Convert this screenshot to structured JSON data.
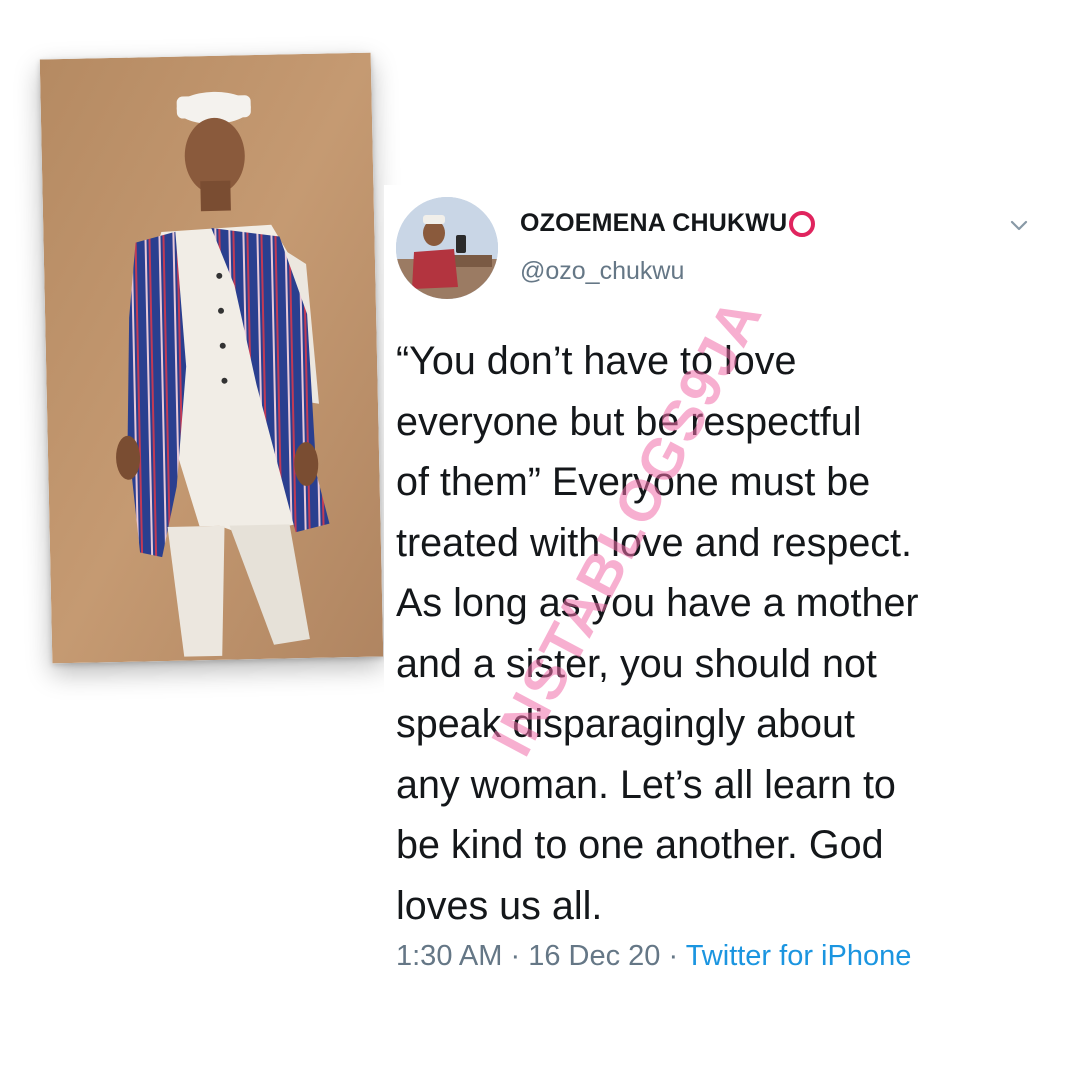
{
  "tweet": {
    "author": {
      "display_name": "OZOEMENA CHUKWU",
      "handle": "@ozo_chukwu"
    },
    "text": "“You don’t have to love\neveryone but be respectful\nof them” Everyone must be\ntreated with love and respect.\nAs long as you have a mother\nand a sister, you should not\nspeak disparagingly about\nany woman. Let’s all learn to\nbe kind to one another. God\nloves us all.",
    "time": "1:30 AM",
    "separator": "·",
    "date": "16 Dec 20",
    "source": "Twitter for iPhone"
  },
  "watermark": {
    "text": "INSTABLOGS9JA"
  },
  "icons": {
    "name_badge": "red-circle-icon",
    "menu": "chevron-down-icon"
  },
  "colors": {
    "name_badge": "#e0245e",
    "source_link": "#1b95e0",
    "secondary_text": "#657786",
    "primary_text": "#14171a",
    "watermark": "#f06ea9"
  }
}
